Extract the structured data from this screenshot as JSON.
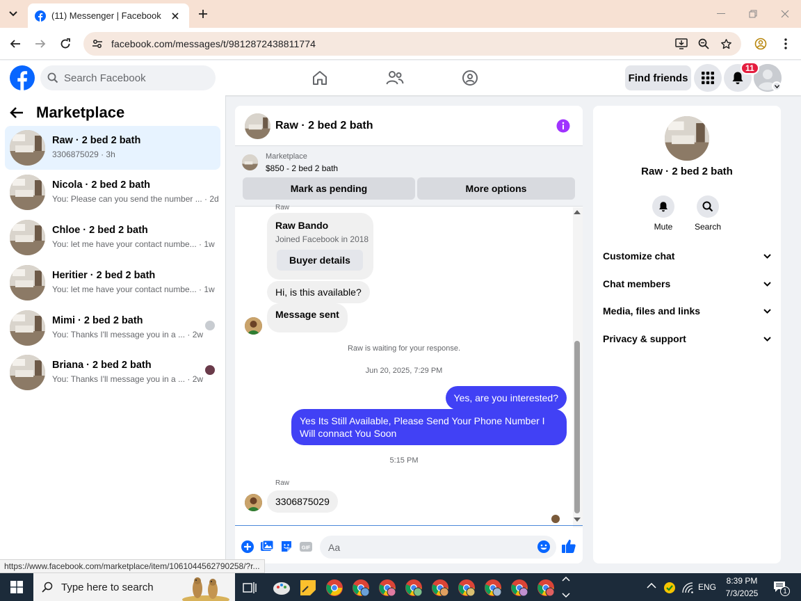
{
  "browser": {
    "tab_title": "(11) Messenger | Facebook",
    "url": "facebook.com/messages/t/9812872438811774",
    "status_url": "https://www.facebook.com/marketplace/item/1061044562790258/?r..."
  },
  "fb_header": {
    "search_placeholder": "Search Facebook",
    "find_friends": "Find friends",
    "notification_count": "11"
  },
  "sidebar": {
    "title": "Marketplace",
    "conversations": [
      {
        "name": "Raw · 2 bed 2 bath",
        "snippet": "3306875029 · 3h",
        "active": true
      },
      {
        "name": "Nicola · 2 bed 2 bath",
        "snippet": "You: Please can you send the number ... · 2d"
      },
      {
        "name": "Chloe · 2 bed 2 bath",
        "snippet": "You: let me have your contact numbe... · 1w"
      },
      {
        "name": "Heritier · 2 bed 2 bath",
        "snippet": "You: let me have your contact numbe... · 1w"
      },
      {
        "name": "Mimi · 2 bed 2 bath",
        "snippet": "You: Thanks I'll message you in a ... · 2w"
      },
      {
        "name": "Briana · 2 bed 2 bath",
        "snippet": "You: Thanks I'll message you in a ... · 2w"
      }
    ]
  },
  "chat": {
    "title": "Raw · 2 bed 2 bath",
    "marketplace_label": "Marketplace",
    "listing": "$850 - 2 bed 2 bath",
    "mark_pending": "Mark as pending",
    "more_options": "More options",
    "top_sender": "Raw",
    "profile_name": "Raw Bando",
    "profile_sub": "Joined Facebook in 2018",
    "buyer_details": "Buyer details",
    "msg_available": "Hi, is this available?",
    "msg_sent": "Message sent",
    "waiting": "Raw is waiting for your response.",
    "timestamp1": "Jun 20, 2025, 7:29 PM",
    "out1": "Yes, are you interested?",
    "out2": "Yes Its Still Available, Please Send Your Phone Number I Will connact You Soon",
    "timestamp2": "5:15 PM",
    "sender2": "Raw",
    "in_number": "3306875029",
    "composer_placeholder": "Aa",
    "accent_color": "#4141f5"
  },
  "info_panel": {
    "name": "Raw · 2 bed 2 bath",
    "mute": "Mute",
    "search": "Search",
    "sections": [
      "Customize chat",
      "Chat members",
      "Media, files and links",
      "Privacy & support"
    ]
  },
  "taskbar": {
    "search_text": "Type here to search",
    "lang": "ENG",
    "time": "8:39 PM",
    "date": "7/3/2025",
    "notif_count": "1"
  }
}
